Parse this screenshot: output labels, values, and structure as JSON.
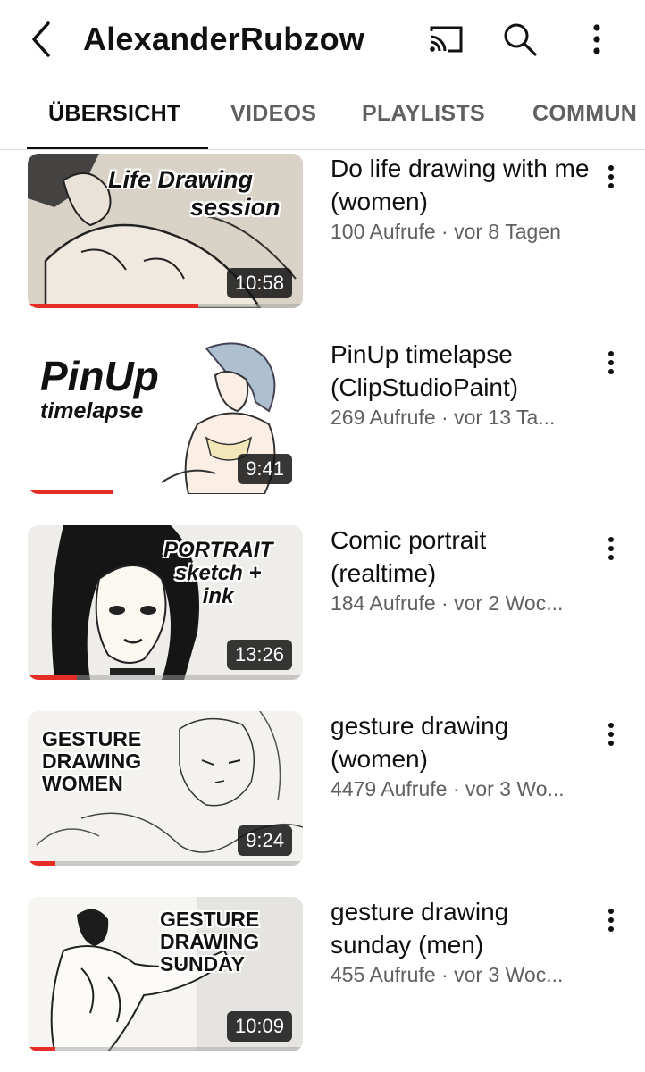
{
  "header": {
    "channel_name": "AlexanderRubzow"
  },
  "tabs": [
    {
      "label": "ÜBERSICHT",
      "active": true
    },
    {
      "label": "VIDEOS",
      "active": false
    },
    {
      "label": "PLAYLISTS",
      "active": false
    },
    {
      "label": "COMMUN",
      "active": false
    }
  ],
  "videos": [
    {
      "title": "Do life drawing with me (women)",
      "subtitle": "100 Aufrufe · vor 8 Tagen",
      "duration": "10:58",
      "thumb_text": [
        "Life Drawing",
        "session"
      ],
      "watch_progress": 0.62
    },
    {
      "title": "PinUp timelapse (ClipStudioPaint)",
      "subtitle": "269 Aufrufe · vor 13 Ta...",
      "duration": "9:41",
      "thumb_text": [
        "PinUp",
        "timelapse"
      ],
      "watch_progress": 0.31
    },
    {
      "title": "Comic portrait (realtime)",
      "subtitle": "184 Aufrufe · vor 2 Woc...",
      "duration": "13:26",
      "thumb_text": [
        "PORTRAIT",
        "sketch +",
        "ink"
      ],
      "watch_progress": 0.18
    },
    {
      "title": "gesture drawing (women)",
      "subtitle": "4479 Aufrufe · vor 3 Wo...",
      "duration": "9:24",
      "thumb_text": [
        "GESTURE",
        "DRAWING",
        "WOMEN"
      ],
      "watch_progress": 0.1
    },
    {
      "title": "gesture drawing sunday (men)",
      "subtitle": "455 Aufrufe · vor 3 Woc...",
      "duration": "10:09",
      "thumb_text": [
        "GESTURE",
        "DRAWING",
        "SUNDAY"
      ],
      "watch_progress": 0.1
    }
  ],
  "icons": {
    "back": "chevron-left-icon",
    "cast": "cast-icon",
    "search": "search-icon",
    "more": "more-vertical-icon"
  },
  "colors": {
    "progress": "#e52d27",
    "text_primary": "#0f0f0f",
    "text_secondary": "#606060"
  }
}
